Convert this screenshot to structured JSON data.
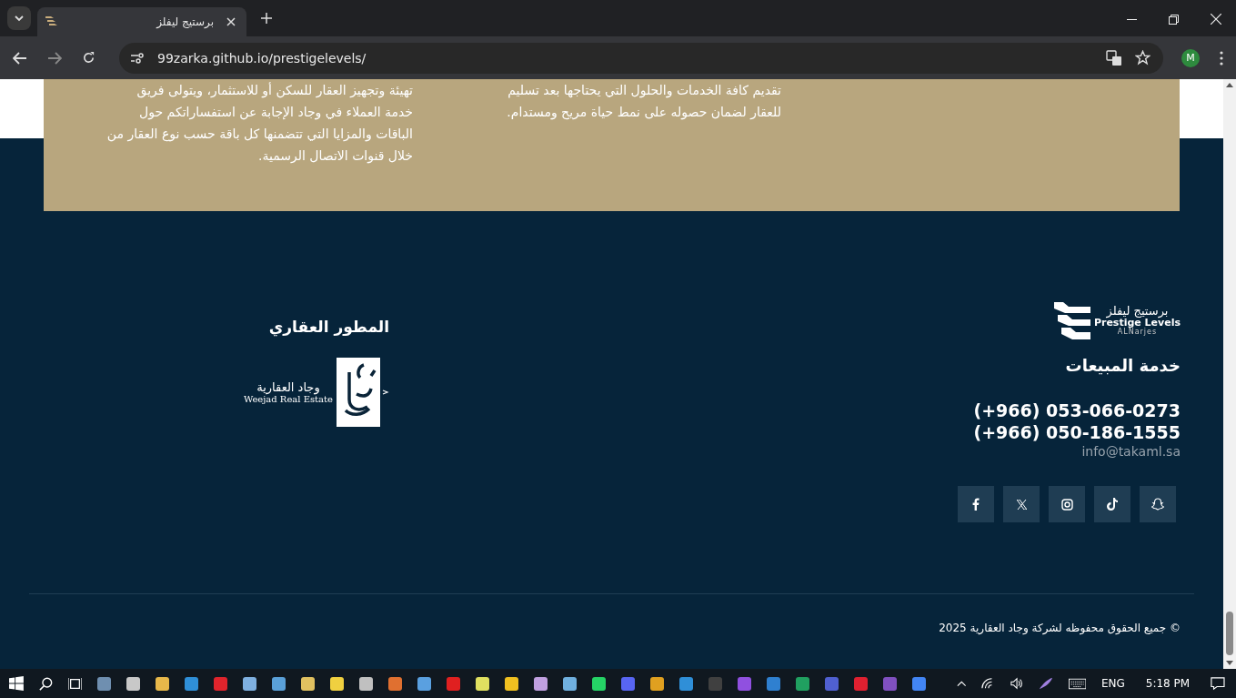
{
  "browser": {
    "tab": {
      "title": "برستيج ليفلز"
    },
    "url": "99zarka.github.io/prestigelevels/",
    "profile": "M"
  },
  "services_panel": {
    "columns": [
      {
        "lines": [
          "تقديم كافة الخدمات والحلول التي يحتاجها بعد تسليم",
          "للعقار لضمان حصوله على نمط حياة مريح ومستدام."
        ]
      },
      {
        "lines": [
          "تهيئة وتجهيز العقار للسكن أو للاستثمار، ويتولى فريق",
          "خدمة العملاء في وجاد الإجابة عن استفساراتكم حول",
          "الباقات والمزايا التي تتضمنها كل باقة حسب نوع العقار من",
          "خلال قنوات الاتصال الرسمية."
        ]
      }
    ]
  },
  "footer": {
    "brand": {
      "name_ar": "برستيج ليفلز",
      "name_en": "Prestige Levels",
      "tagline": "ALNarjes"
    },
    "sales": {
      "title": "خدمة المبيعات",
      "phones": [
        "(+966) 053-066-0273",
        "(+966) 050-186-1555"
      ],
      "email": "info@takaml.sa"
    },
    "developer": {
      "title": "المطور العقاري",
      "logo_ar": "وجاد العقارية",
      "logo_en": "Weejad Real Estate"
    },
    "copyright": "© جميع الحقوق محفوظه لشركة وجاد العقارية 2025"
  },
  "taskbar": {
    "language": "ENG",
    "time": "5:18 PM"
  }
}
